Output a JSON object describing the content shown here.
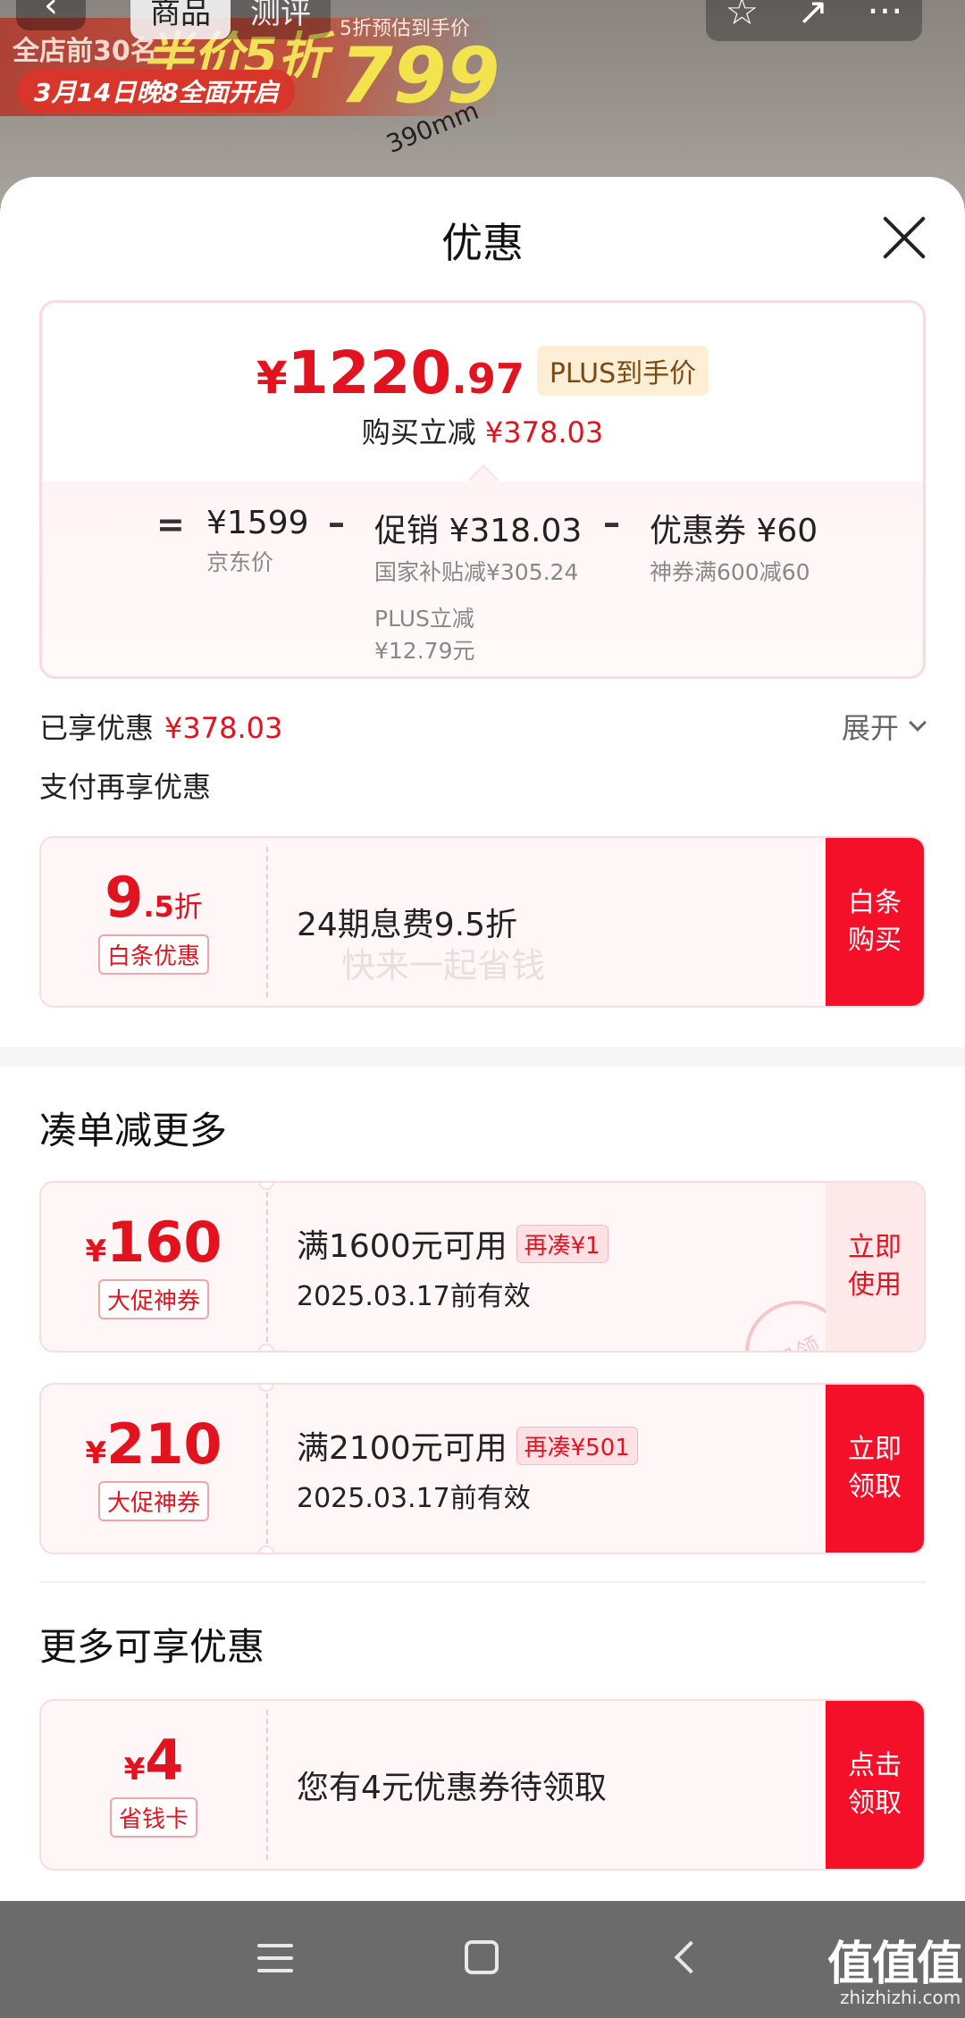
{
  "background_page": {
    "nav": {
      "back_icon": "‹",
      "tabs": [
        "商品",
        "测评"
      ],
      "active_tab": 0,
      "actions": [
        "☆",
        "↗",
        "···"
      ]
    },
    "promo": {
      "store_rank": "全店前30名",
      "half_price": "半价5折",
      "date_banner": "3月14日晚8全面开启",
      "estimate_note": "5折预估到手价",
      "estimate_price": "799",
      "dimension": "390mm"
    }
  },
  "sheet": {
    "title": "优惠",
    "price": {
      "currency": "¥",
      "integer": "1220",
      "decimal": ".97",
      "plus_tag": "PLUS到手价",
      "instant_cut_label": "购买立减",
      "instant_cut_value": "¥378.03"
    },
    "formula": {
      "eq": "=",
      "minus": "–",
      "jd_price": {
        "value": "¥1599",
        "label": "京东价"
      },
      "promotion": {
        "value": "促销 ¥318.03",
        "detail1": "国家补贴减¥305.24",
        "detail2a": "PLUS立减",
        "detail2b": "¥12.79元"
      },
      "coupon": {
        "value": "优惠券 ¥60",
        "detail": "神券满600减60"
      }
    },
    "enjoyed": {
      "label": "已享优惠",
      "value": "¥378.03",
      "expand_label": "展开"
    },
    "pay_section_title": "支付再享优惠",
    "baitiao": {
      "amount_int": "9",
      "amount_frac": ".5",
      "amount_unit": "折",
      "tag": "白条优惠",
      "main_text": "24期息费9.5折",
      "watermark": "快来一起省钱",
      "btn_line1": "白条",
      "btn_line2": "购买"
    },
    "combo_section_title": "凑单减更多",
    "coupons": [
      {
        "currency": "¥",
        "amount": "160",
        "tag": "大促神券",
        "condition": "满1600元可用",
        "extra_tag": "再凑¥1",
        "validity": "2025.03.17前有效",
        "btn_line1": "立即",
        "btn_line2": "使用",
        "stamp": "已领"
      },
      {
        "currency": "¥",
        "amount": "210",
        "tag": "大促神券",
        "condition": "满2100元可用",
        "extra_tag": "再凑¥501",
        "validity": "2025.03.17前有效",
        "btn_line1": "立即",
        "btn_line2": "领取"
      }
    ],
    "more_section_title": "更多可享优惠",
    "saving_card": {
      "currency": "¥",
      "amount": "4",
      "tag": "省钱卡",
      "main_text": "您有4元优惠券待领取",
      "btn_line1": "点击",
      "btn_line2": "领取"
    }
  },
  "system_bar": {
    "menu_icon": "menu-icon",
    "home_icon": "home-icon",
    "back_icon": "back-icon"
  },
  "site_watermark": {
    "logo": "值值值",
    "url": "zhizhizhi.com"
  },
  "colors": {
    "accent_red": "#e2131f",
    "button_red": "#f5102a",
    "plus_bg": "#fdeed6"
  }
}
